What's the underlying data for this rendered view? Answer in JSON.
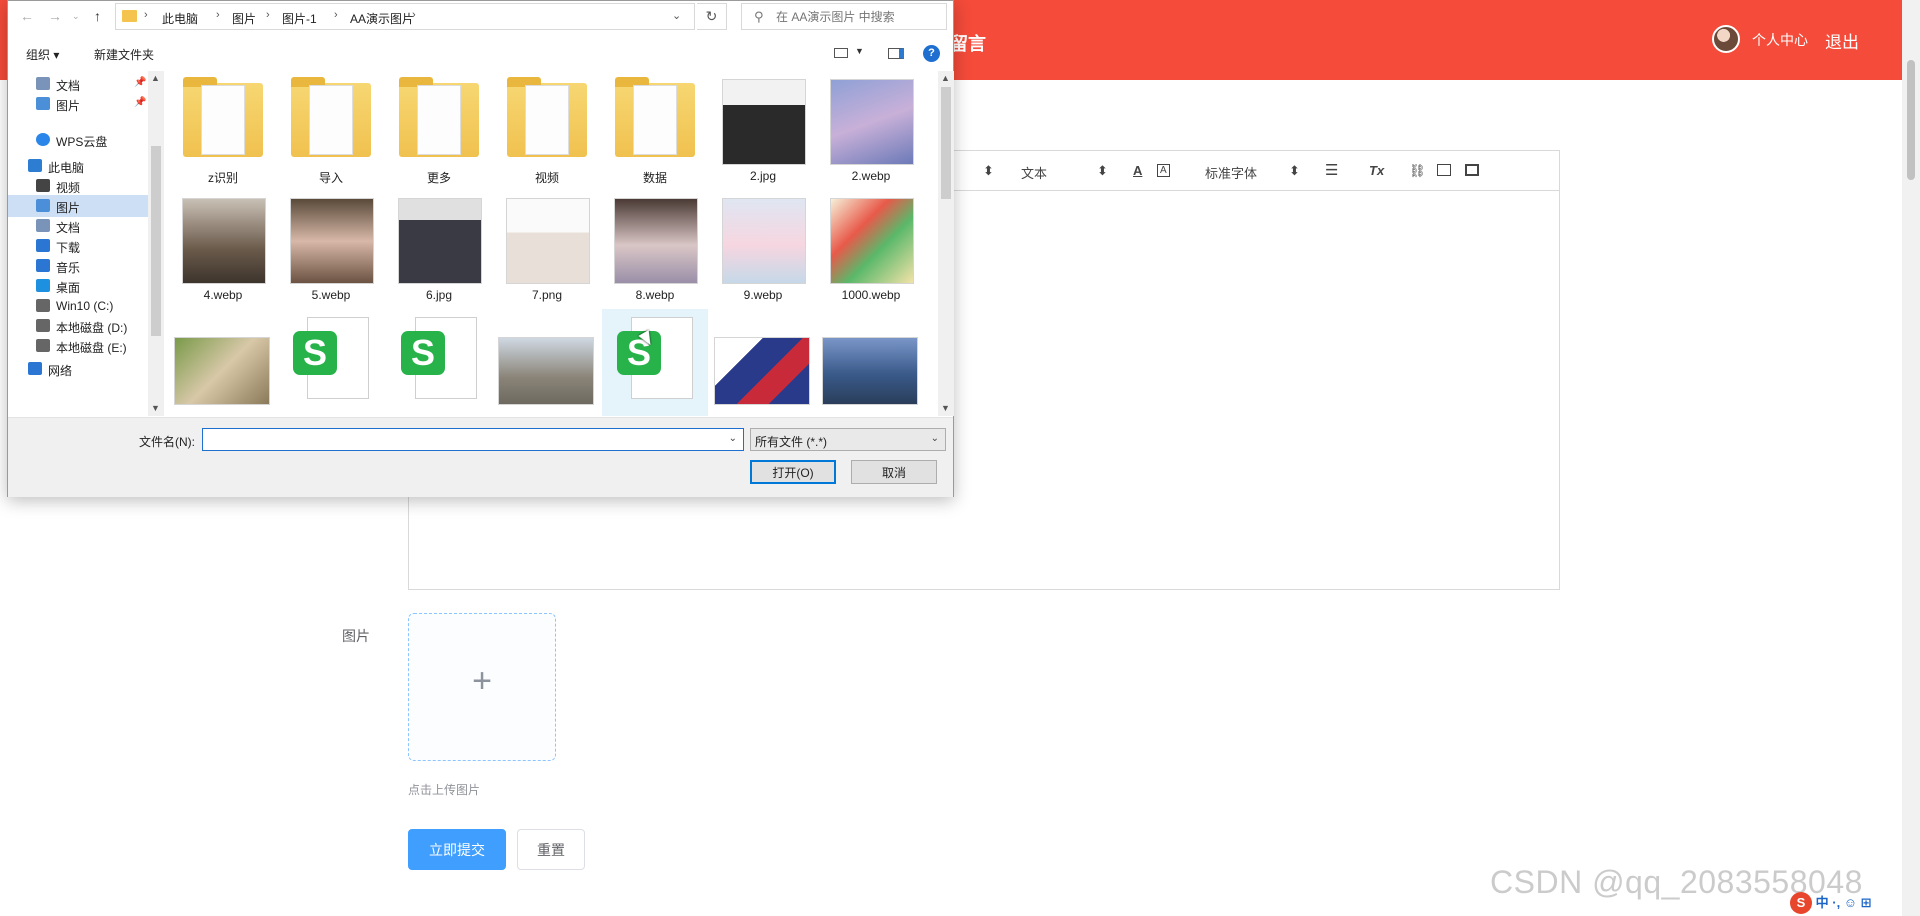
{
  "site": {
    "nav_partial": "留言",
    "user_center": "个人中心",
    "logout": "退出",
    "editor_toolbar": {
      "header_select": "文本",
      "font_select": "标准字体"
    },
    "image_field_label": "图片",
    "upload_tip": "点击上传图片",
    "submit_label": "立即提交",
    "reset_label": "重置",
    "watermark": "CSDN @qq_2083558048",
    "ime_text": "中 ·, ☺ ⊞"
  },
  "dialog": {
    "breadcrumb": [
      "此电脑",
      "图片",
      "图片-1",
      "AA演示图片"
    ],
    "search_placeholder": "在 AA演示图片 中搜索",
    "organize_label": "组织 ▾",
    "new_folder_label": "新建文件夹",
    "help_label": "?",
    "nav_items": [
      {
        "label": "文档",
        "icon": "document-icon",
        "pinned": true
      },
      {
        "label": "图片",
        "icon": "pictures-icon",
        "pinned": true
      },
      {
        "label": "WPS云盘",
        "icon": "cloud-icon"
      },
      {
        "label": "此电脑",
        "icon": "computer-icon"
      },
      {
        "label": "视频",
        "icon": "video-icon"
      },
      {
        "label": "图片",
        "icon": "pictures-icon",
        "selected": true
      },
      {
        "label": "文档",
        "icon": "document-icon"
      },
      {
        "label": "下载",
        "icon": "download-icon"
      },
      {
        "label": "音乐",
        "icon": "music-icon"
      },
      {
        "label": "桌面",
        "icon": "desktop-icon"
      },
      {
        "label": "Win10 (C:)",
        "icon": "drive-icon"
      },
      {
        "label": "本地磁盘 (D:)",
        "icon": "drive-icon"
      },
      {
        "label": "本地磁盘 (E:)",
        "icon": "drive-icon"
      },
      {
        "label": "网络",
        "icon": "network-icon"
      }
    ],
    "files": [
      {
        "name": "z识别",
        "kind": "folder"
      },
      {
        "name": "导入",
        "kind": "folder"
      },
      {
        "name": "更多",
        "kind": "folder"
      },
      {
        "name": "视频",
        "kind": "folder"
      },
      {
        "name": "数据",
        "kind": "folder"
      },
      {
        "name": "2.jpg",
        "kind": "photo"
      },
      {
        "name": "2.webp",
        "kind": "photo"
      },
      {
        "name": "4.webp",
        "kind": "photo"
      },
      {
        "name": "5.webp",
        "kind": "photo"
      },
      {
        "name": "6.jpg",
        "kind": "photo"
      },
      {
        "name": "7.png",
        "kind": "photo"
      },
      {
        "name": "8.webp",
        "kind": "photo"
      },
      {
        "name": "9.webp",
        "kind": "photo"
      },
      {
        "name": "1000.webp",
        "kind": "photo"
      },
      {
        "name": "",
        "kind": "photo"
      },
      {
        "name": "",
        "kind": "spreadsheet"
      },
      {
        "name": "",
        "kind": "spreadsheet"
      },
      {
        "name": "",
        "kind": "photo"
      },
      {
        "name": "",
        "kind": "spreadsheet"
      },
      {
        "name": "",
        "kind": "photo"
      },
      {
        "name": "",
        "kind": "photo"
      }
    ],
    "filename_label": "文件名(N):",
    "filename_value": "",
    "filetype_value": "所有文件 (*.*)",
    "open_label": "打开(O)",
    "cancel_label": "取消"
  }
}
